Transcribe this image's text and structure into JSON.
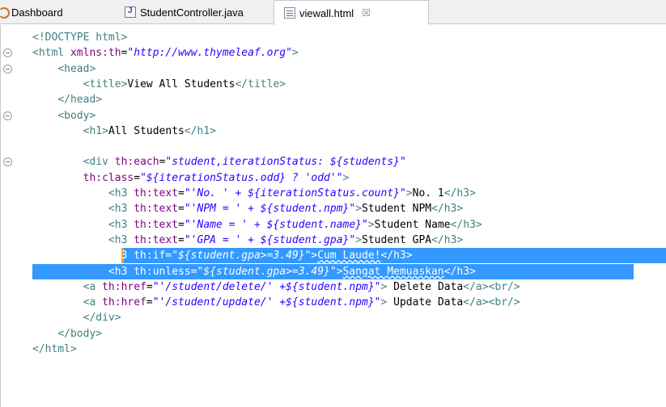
{
  "tabs": [
    {
      "label": "Dashboard"
    },
    {
      "label": "StudentController.java",
      "icon_text": "J"
    },
    {
      "label": "viewall.html",
      "close": "☒"
    }
  ],
  "code_lines": [
    {
      "fold": false,
      "tokens": [
        [
          "tag",
          "<!DOCTYPE html>"
        ]
      ]
    },
    {
      "fold": true,
      "tokens": [
        [
          "tag",
          "<html "
        ],
        [
          "attr",
          "xmlns:th"
        ],
        [
          "text",
          "="
        ],
        [
          "str",
          "\"http://www.thymeleaf.org\""
        ],
        [
          "tag",
          ">"
        ]
      ]
    },
    {
      "fold": true,
      "tokens": [
        [
          "text",
          "    "
        ],
        [
          "tag",
          "<head>"
        ]
      ]
    },
    {
      "fold": false,
      "tokens": [
        [
          "text",
          "        "
        ],
        [
          "tag",
          "<title>"
        ],
        [
          "text",
          "View All Students"
        ],
        [
          "tag",
          "</title>"
        ]
      ]
    },
    {
      "fold": false,
      "tokens": [
        [
          "text",
          "    "
        ],
        [
          "tag",
          "</head>"
        ]
      ]
    },
    {
      "fold": true,
      "tokens": [
        [
          "text",
          "    "
        ],
        [
          "tag",
          "<body>"
        ]
      ]
    },
    {
      "fold": false,
      "tokens": [
        [
          "text",
          "        "
        ],
        [
          "tag",
          "<h1>"
        ],
        [
          "text",
          "All Students"
        ],
        [
          "tag",
          "</h1>"
        ]
      ]
    },
    {
      "fold": false,
      "tokens": []
    },
    {
      "fold": true,
      "tokens": [
        [
          "text",
          "        "
        ],
        [
          "tag",
          "<div "
        ],
        [
          "attr",
          "th:each"
        ],
        [
          "text",
          "="
        ],
        [
          "str",
          "\"student,iterationStatus: ${students}\""
        ]
      ]
    },
    {
      "fold": false,
      "tokens": [
        [
          "text",
          "        "
        ],
        [
          "attr",
          "th:class"
        ],
        [
          "text",
          "="
        ],
        [
          "str",
          "\"${iterationStatus.odd} ? 'odd'\""
        ],
        [
          "tag",
          ">"
        ]
      ]
    },
    {
      "fold": false,
      "tokens": [
        [
          "text",
          "            "
        ],
        [
          "tag",
          "<h3 "
        ],
        [
          "attr",
          "th:text"
        ],
        [
          "text",
          "="
        ],
        [
          "str",
          "\"'No. ' + ${iterationStatus.count}\""
        ],
        [
          "tag",
          ">"
        ],
        [
          "text",
          "No. 1"
        ],
        [
          "tag",
          "</h3>"
        ]
      ]
    },
    {
      "fold": false,
      "tokens": [
        [
          "text",
          "            "
        ],
        [
          "tag",
          "<h3 "
        ],
        [
          "attr",
          "th:text"
        ],
        [
          "text",
          "="
        ],
        [
          "str",
          "\"'NPM = ' + ${student.npm}\""
        ],
        [
          "tag",
          ">"
        ],
        [
          "text",
          "Student NPM"
        ],
        [
          "tag",
          "</h3>"
        ]
      ]
    },
    {
      "fold": false,
      "tokens": [
        [
          "text",
          "            "
        ],
        [
          "tag",
          "<h3 "
        ],
        [
          "attr",
          "th:text"
        ],
        [
          "text",
          "="
        ],
        [
          "str",
          "\"'Name = ' + ${student.name}\""
        ],
        [
          "tag",
          ">"
        ],
        [
          "text",
          "Student Name"
        ],
        [
          "tag",
          "</h3>"
        ]
      ]
    },
    {
      "fold": false,
      "tokens": [
        [
          "text",
          "            "
        ],
        [
          "tag",
          "<h3 "
        ],
        [
          "attr",
          "th:text"
        ],
        [
          "text",
          "="
        ],
        [
          "str",
          "\"'GPA = ' + ${student.gpa}\""
        ],
        [
          "tag",
          ">"
        ],
        [
          "text",
          "Student GPA"
        ],
        [
          "tag",
          "</h3>"
        ]
      ]
    },
    {
      "fold": false,
      "selected": "partial",
      "tokens": [
        [
          "text",
          "            "
        ],
        [
          "tag",
          "<h3 "
        ],
        [
          "attr",
          "th:if"
        ],
        [
          "text",
          "="
        ],
        [
          "str",
          "\"${student.gpa>=3.49}\""
        ],
        [
          "tag",
          ">"
        ],
        [
          "text",
          "Cum Laude!"
        ],
        [
          "tag",
          "</h3>"
        ]
      ]
    },
    {
      "fold": false,
      "selected": "full",
      "tokens": [
        [
          "text",
          "            "
        ],
        [
          "tag",
          "<h3 "
        ],
        [
          "attr",
          "th:unless"
        ],
        [
          "text",
          "="
        ],
        [
          "str",
          "\"${student.gpa>=3.49}\""
        ],
        [
          "tag",
          ">"
        ],
        [
          "text",
          "Sangat Memuaskan"
        ],
        [
          "tag",
          "</h3>"
        ]
      ]
    },
    {
      "fold": false,
      "tokens": [
        [
          "text",
          "        "
        ],
        [
          "tag",
          "<a "
        ],
        [
          "attr",
          "th:href"
        ],
        [
          "text",
          "="
        ],
        [
          "str",
          "\"'/student/delete/' +${student.npm}\""
        ],
        [
          "tag",
          ">"
        ],
        [
          "text",
          " Delete Data"
        ],
        [
          "tag",
          "</a><br/>"
        ]
      ]
    },
    {
      "fold": false,
      "tokens": [
        [
          "text",
          "        "
        ],
        [
          "tag",
          "<a "
        ],
        [
          "attr",
          "th:href"
        ],
        [
          "text",
          "="
        ],
        [
          "str",
          "\"'/student/update/' +${student.npm}\""
        ],
        [
          "tag",
          ">"
        ],
        [
          "text",
          " Update Data"
        ],
        [
          "tag",
          "</a><br/>"
        ]
      ]
    },
    {
      "fold": false,
      "tokens": [
        [
          "text",
          "        "
        ],
        [
          "tag",
          "</div>"
        ]
      ]
    },
    {
      "fold": false,
      "tokens": [
        [
          "text",
          "    "
        ],
        [
          "tag",
          "</body>"
        ]
      ]
    },
    {
      "fold": false,
      "tokens": [
        [
          "tag",
          "</html>"
        ]
      ]
    }
  ],
  "colors": {
    "tag": "#3f7f7f",
    "attr": "#7f007f",
    "string": "#2a00ff",
    "selection": "#3399ff"
  }
}
